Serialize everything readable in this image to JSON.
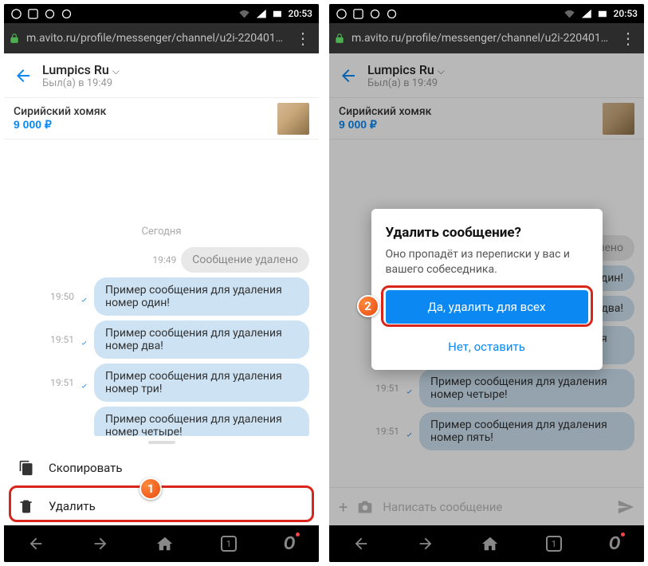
{
  "status": {
    "time": "20:53"
  },
  "url": "m.avito.ru/profile/messenger/channel/u2i-220401…",
  "header": {
    "name": "Lumpics Ru",
    "status": "Был(а) в 19:49"
  },
  "item": {
    "title": "Сирийский хомяк",
    "price": "9 000 ₽"
  },
  "chat": {
    "day": "Сегодня",
    "deleted_label": "Сообщение удалено",
    "msgs": [
      {
        "time": "19:49"
      },
      {
        "time": "19:50",
        "text": "Пример сообщения для удаления номер один!"
      },
      {
        "time": "19:51",
        "text": "Пример сообщения для удаления номер два!"
      },
      {
        "time": "19:51",
        "text": "Пример сообщения для удаления номер три!"
      },
      {
        "time": "19:51",
        "text": "Пример сообщения для удаления номер четыре!"
      },
      {
        "time": "19:51",
        "text": "Пример сообщения для удаления номер пять!"
      }
    ],
    "input_placeholder": "Написать сообщение"
  },
  "sheet": {
    "copy": "Скопировать",
    "delete": "Удалить"
  },
  "modal": {
    "title": "Удалить сообщение?",
    "body": "Оно пропадёт из переписки у вас и вашего собеседника.",
    "confirm": "Да, удалить для всех",
    "cancel": "Нет, оставить"
  },
  "steps": {
    "one": "1",
    "two": "2"
  },
  "nav": {
    "tabs": "1"
  }
}
